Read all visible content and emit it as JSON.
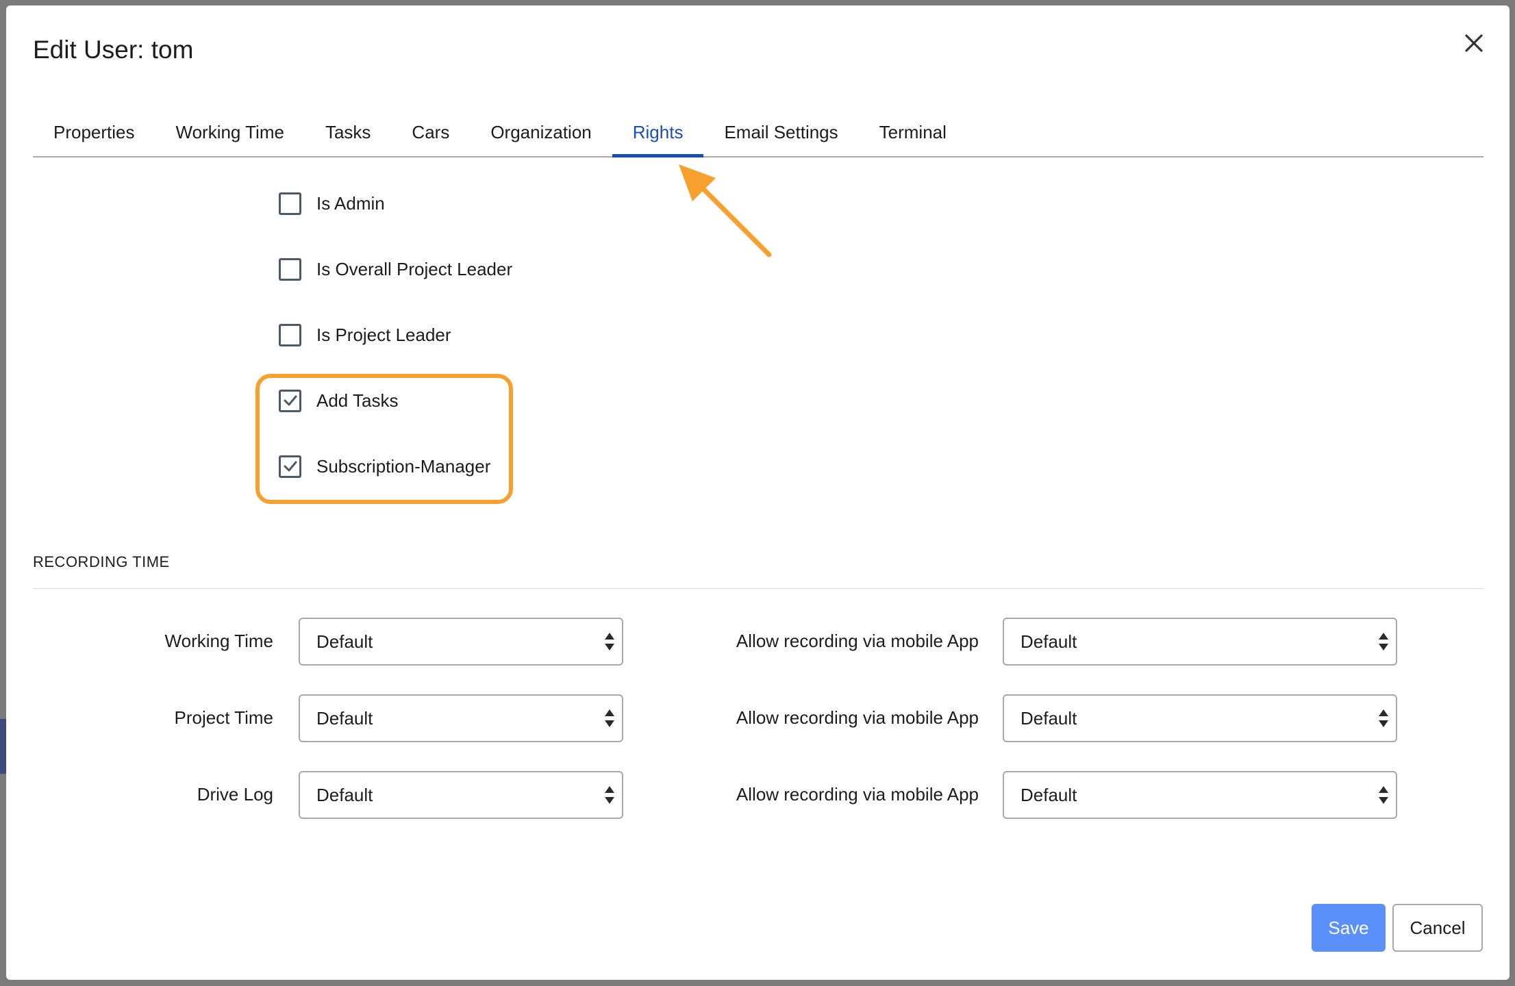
{
  "modal": {
    "title": "Edit User: tom"
  },
  "tabs": [
    {
      "label": "Properties",
      "active": false
    },
    {
      "label": "Working Time",
      "active": false
    },
    {
      "label": "Tasks",
      "active": false
    },
    {
      "label": "Cars",
      "active": false
    },
    {
      "label": "Organization",
      "active": false
    },
    {
      "label": "Rights",
      "active": true
    },
    {
      "label": "Email Settings",
      "active": false
    },
    {
      "label": "Terminal",
      "active": false
    }
  ],
  "rights": [
    {
      "label": "Is Admin",
      "checked": false
    },
    {
      "label": "Is Overall Project Leader",
      "checked": false
    },
    {
      "label": "Is Project Leader",
      "checked": false
    },
    {
      "label": "Add Tasks",
      "checked": true
    },
    {
      "label": "Subscription-Manager",
      "checked": true
    }
  ],
  "recording": {
    "section_title": "RECORDING TIME",
    "rows": [
      {
        "label": "Working Time",
        "value": "Default",
        "mobile_label": "Allow recording via mobile App",
        "mobile_value": "Default"
      },
      {
        "label": "Project Time",
        "value": "Default",
        "mobile_label": "Allow recording via mobile App",
        "mobile_value": "Default"
      },
      {
        "label": "Drive Log",
        "value": "Default",
        "mobile_label": "Allow recording via mobile App",
        "mobile_value": "Default"
      }
    ]
  },
  "footer": {
    "save_label": "Save",
    "cancel_label": "Cancel"
  },
  "colors": {
    "accent": "#1a4fb4",
    "save_button": "#5b8ff9",
    "annotation": "#f7a02d"
  },
  "icons": {
    "close": "close-icon",
    "check": "checkmark-icon",
    "select_arrows": "sort-arrows-icon",
    "annotation": "arrow-annotation-icon"
  }
}
